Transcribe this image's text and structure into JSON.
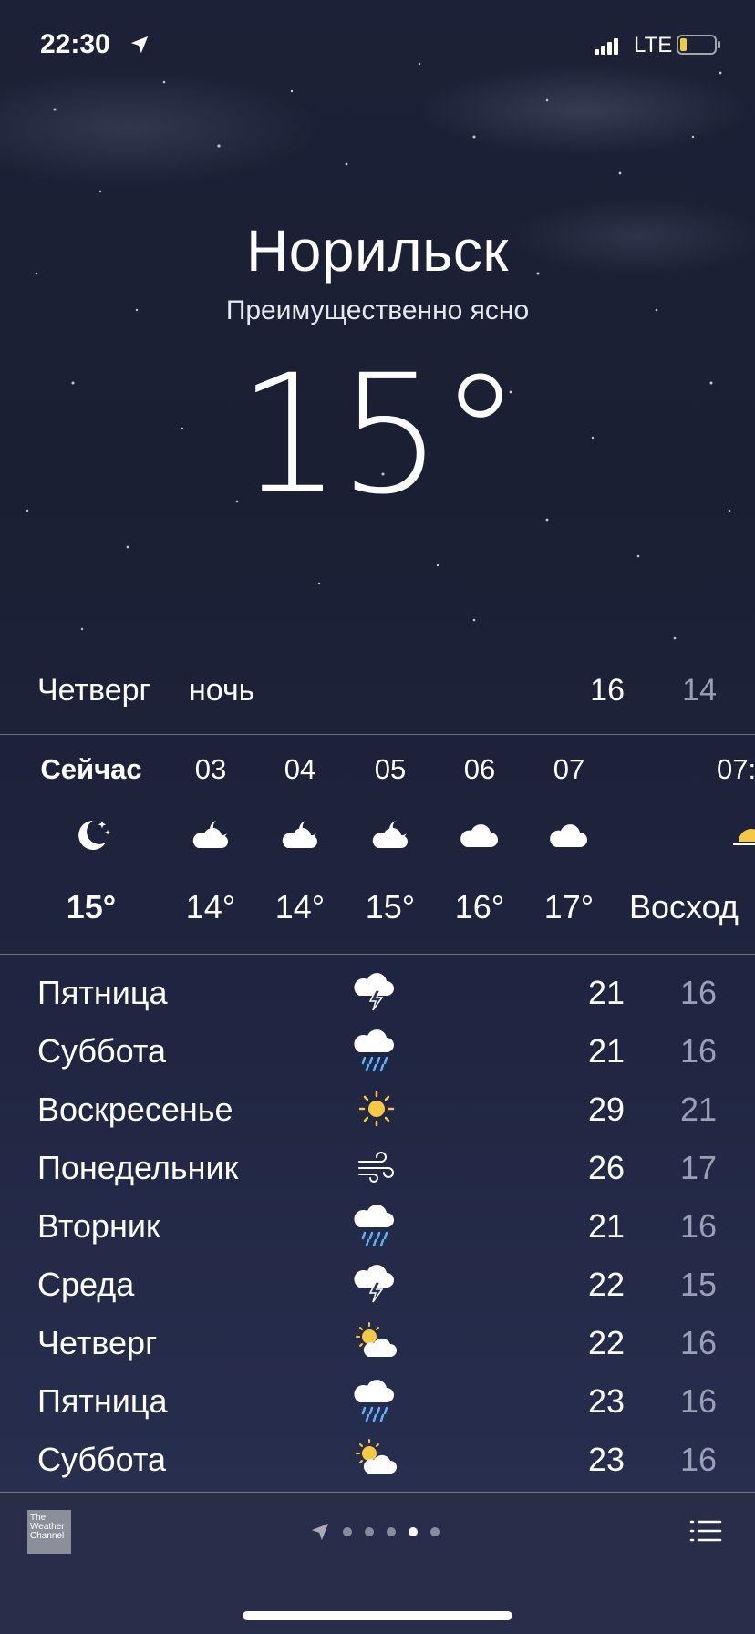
{
  "status": {
    "time": "22:30",
    "network": "LTE"
  },
  "location": {
    "city": "Норильск",
    "condition": "Преимущественно ясно",
    "temperature": "15°"
  },
  "today": {
    "day": "Четверг",
    "period": "ночь",
    "high": "16",
    "low": "14"
  },
  "hourly": [
    {
      "time": "Сейчас",
      "icon": "moon-stars-icon",
      "temp": "15°"
    },
    {
      "time": "03",
      "icon": "cloud-moon-icon",
      "temp": "14°"
    },
    {
      "time": "04",
      "icon": "cloud-moon-icon",
      "temp": "14°"
    },
    {
      "time": "05",
      "icon": "cloud-moon-icon",
      "temp": "15°"
    },
    {
      "time": "06",
      "icon": "cloud-icon",
      "temp": "16°"
    },
    {
      "time": "07",
      "icon": "cloud-icon",
      "temp": "17°"
    },
    {
      "time": "07:",
      "icon": "sunrise-icon",
      "temp": "Восход"
    }
  ],
  "daily": [
    {
      "day": "Пятница",
      "icon": "thunderstorm-icon",
      "high": "21",
      "low": "16"
    },
    {
      "day": "Суббота",
      "icon": "rain-icon",
      "high": "21",
      "low": "16"
    },
    {
      "day": "Воскресенье",
      "icon": "sun-icon",
      "high": "29",
      "low": "21"
    },
    {
      "day": "Понедельник",
      "icon": "wind-icon",
      "high": "26",
      "low": "17"
    },
    {
      "day": "Вторник",
      "icon": "rain-icon",
      "high": "21",
      "low": "16"
    },
    {
      "day": "Среда",
      "icon": "thunderstorm-icon",
      "high": "22",
      "low": "15"
    },
    {
      "day": "Четверг",
      "icon": "partly-cloudy-icon",
      "high": "22",
      "low": "16"
    },
    {
      "day": "Пятница",
      "icon": "rain-icon",
      "high": "23",
      "low": "16"
    },
    {
      "day": "Суббота",
      "icon": "partly-cloudy-icon",
      "high": "23",
      "low": "16"
    }
  ],
  "footer": {
    "logo_text": "The Weather Channel",
    "pages": 5,
    "active_page": 4
  },
  "colors": {
    "sun": "#f6c945",
    "rain": "#5eb0ff",
    "low_temp": "#9aa0b3"
  }
}
